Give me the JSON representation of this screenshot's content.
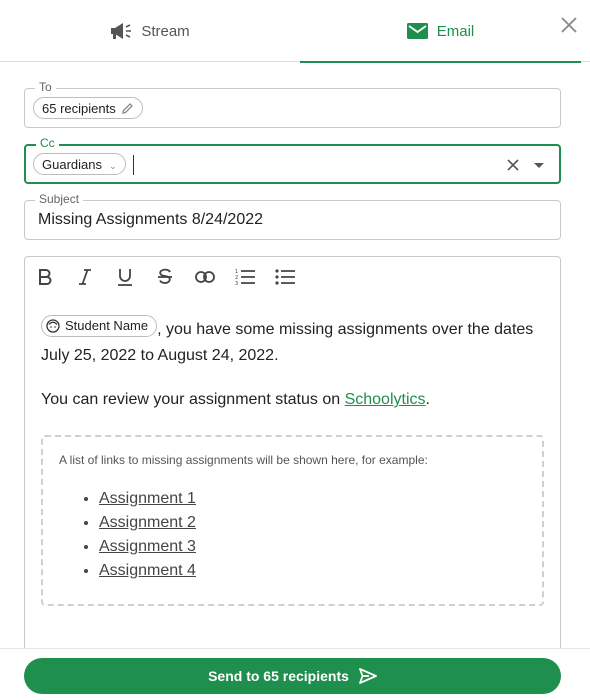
{
  "tabs": {
    "stream_label": "Stream",
    "email_label": "Email",
    "active": "Email"
  },
  "form": {
    "to": {
      "label": "To",
      "chip": "65 recipients"
    },
    "cc": {
      "label": "Cc",
      "chip": "Guardians"
    },
    "subject": {
      "label": "Subject",
      "value": "Missing Assignments 8/24/2022"
    }
  },
  "toolbar": {
    "buttons": [
      "bold-icon",
      "italic-icon",
      "underline-icon",
      "strikethrough-icon",
      "link-icon",
      "ordered-list-icon",
      "bulleted-list-icon"
    ]
  },
  "body": {
    "student_chip": "Student Name",
    "line1": ", you have some missing assignments over the dates July 25, 2022 to August 24, 2022.",
    "line2_before": "You can review your assignment status on ",
    "line2_link": "Schoolytics",
    "line2_after": ".",
    "placeholder_note": "A list of links to missing assignments will be shown here, for example:",
    "assignments": [
      "Assignment 1",
      "Assignment 2",
      "Assignment 3",
      "Assignment 4"
    ]
  },
  "footer": {
    "send_label": "Send to 65 recipients"
  },
  "colors": {
    "accent": "#1f8f4e",
    "border": "#c8c8c8"
  }
}
